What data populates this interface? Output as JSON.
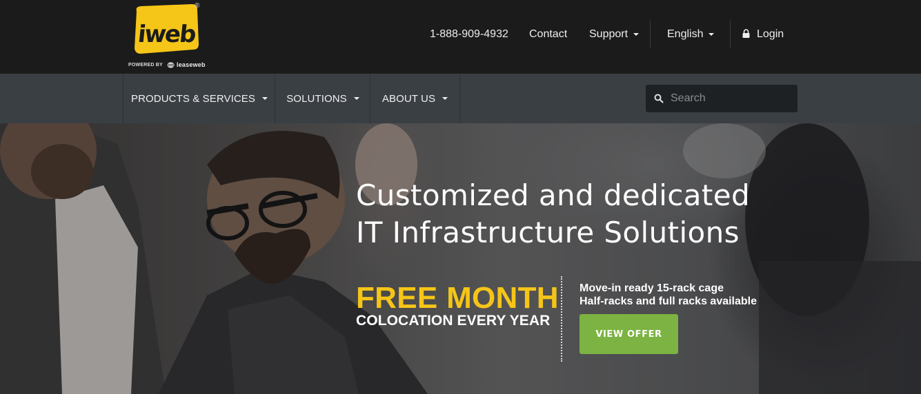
{
  "header": {
    "logo": {
      "wordmark": "iweb",
      "registered": "®",
      "powered_by": "POWERED BY",
      "partner": "leaseweb"
    },
    "phone": "1-888-909-4932",
    "contact": "Contact",
    "support": "Support",
    "language": "English",
    "login": "Login"
  },
  "mainnav": {
    "items": [
      {
        "label": "PRODUCTS & SERVICES"
      },
      {
        "label": "SOLUTIONS"
      },
      {
        "label": "ABOUT US"
      }
    ],
    "search": {
      "placeholder": "Search",
      "value": ""
    }
  },
  "hero": {
    "headline_line1": "Customized and dedicated",
    "headline_line2": "IT Infrastructure Solutions",
    "promo_title": "FREE MONTH",
    "promo_subtitle": "COLOCATION EVERY YEAR",
    "offer_line1": "Move-in ready 15-rack cage",
    "offer_line2": "Half-racks and full racks available",
    "offer_button": "VIEW OFFER"
  },
  "colors": {
    "topbar": "#1b1b1b",
    "mainnav": "#3a3f44",
    "brand_yellow": "#f5c518",
    "button_green": "#7cb342"
  },
  "icons": [
    "caret-down-icon",
    "lock-icon",
    "search-icon",
    "leaseweb-icon"
  ]
}
